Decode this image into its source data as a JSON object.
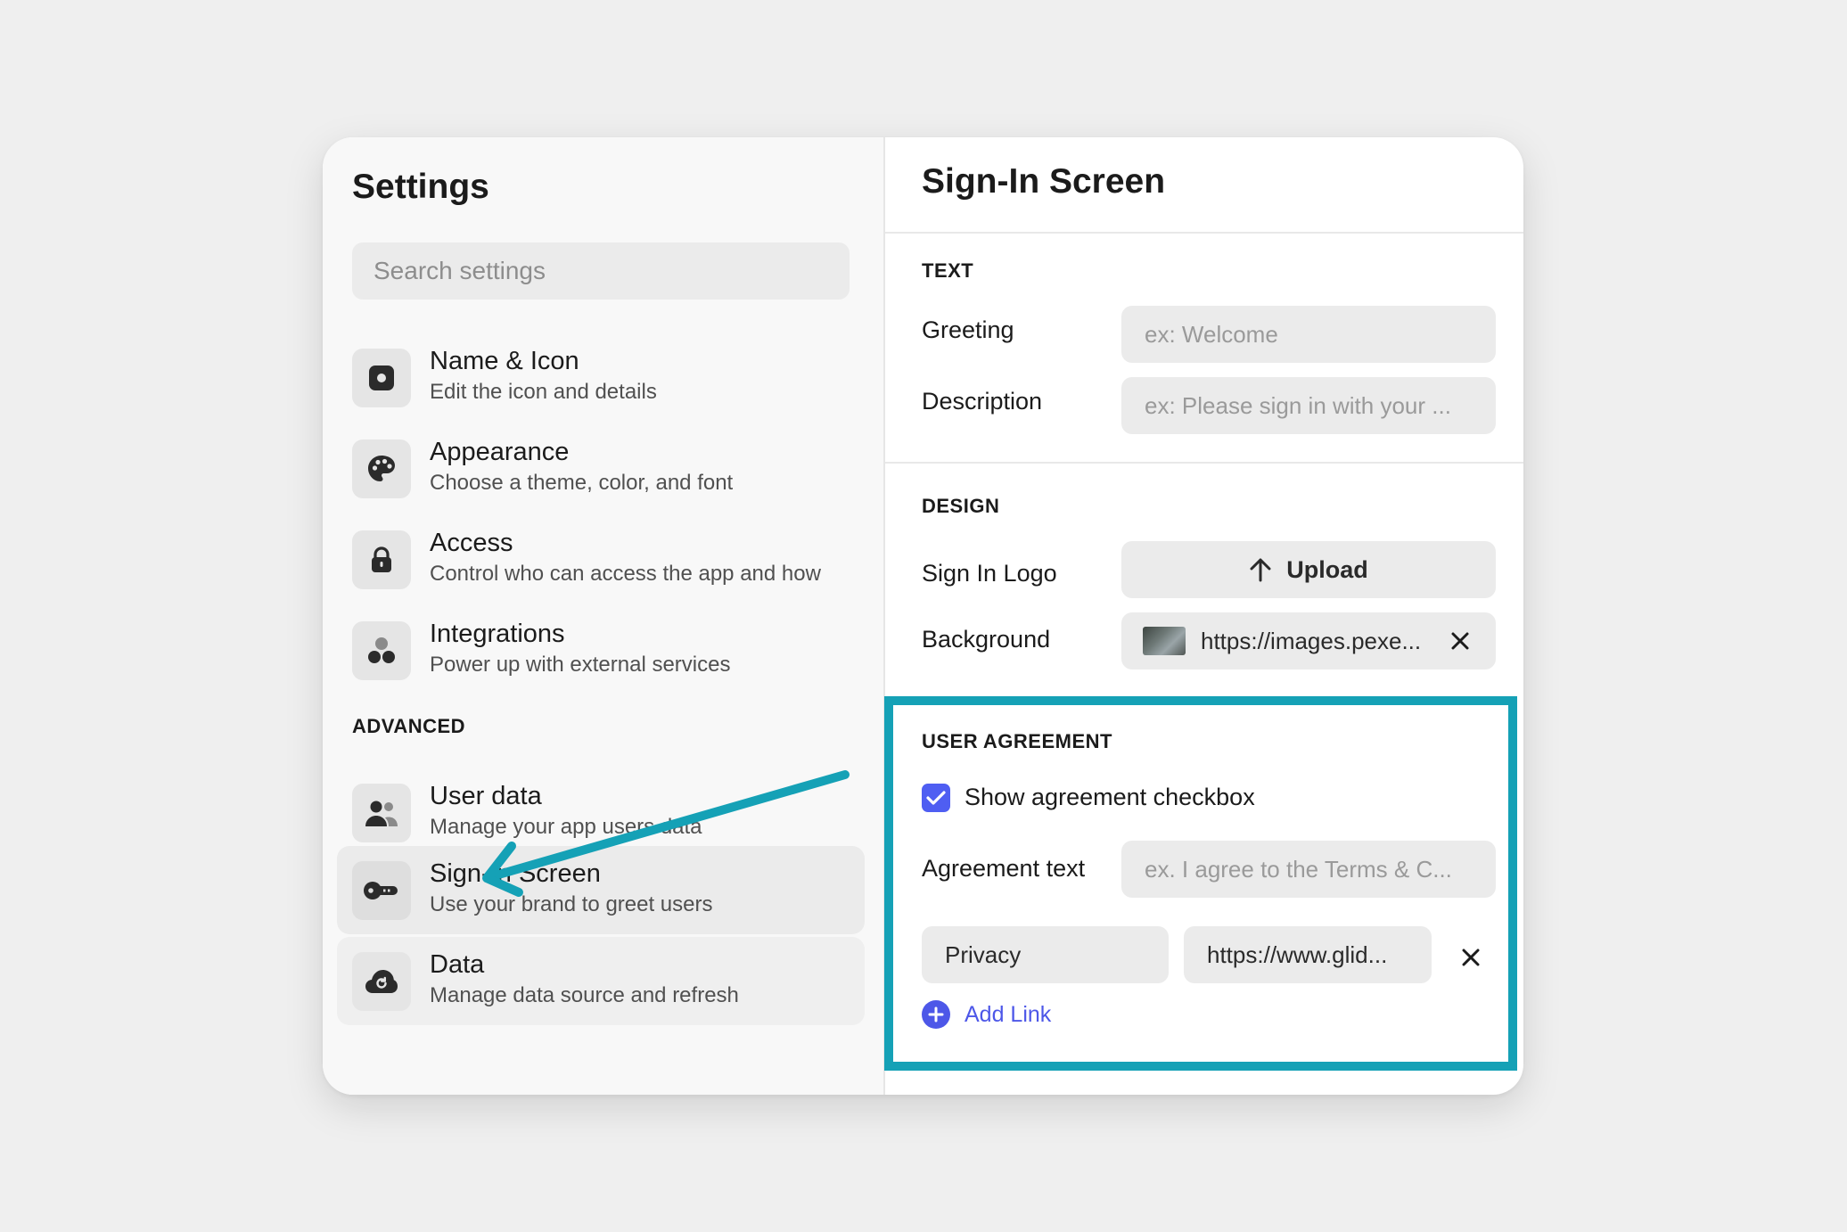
{
  "sidebar": {
    "title": "Settings",
    "search_placeholder": "Search settings",
    "items": [
      {
        "title": "Name & Icon",
        "desc": "Edit the icon and details",
        "icon": "square-dot-icon"
      },
      {
        "title": "Appearance",
        "desc": "Choose a theme, color, and font",
        "icon": "palette-icon"
      },
      {
        "title": "Access",
        "desc": "Control who can access the app and how",
        "icon": "lock-icon"
      },
      {
        "title": "Integrations",
        "desc": "Power up with external services",
        "icon": "integrations-icon"
      }
    ],
    "advanced_label": "ADVANCED",
    "advanced_items": [
      {
        "title": "User data",
        "desc": "Manage your app users data",
        "icon": "users-icon"
      },
      {
        "title": "Sign-In Screen",
        "desc": "Use your brand to greet users",
        "icon": "key-icon",
        "selected": true
      },
      {
        "title": "Data",
        "desc": "Manage data source and refresh",
        "icon": "cloud-refresh-icon"
      }
    ]
  },
  "main": {
    "title": "Sign-In Screen",
    "text_section": {
      "label": "TEXT",
      "greeting_label": "Greeting",
      "greeting_placeholder": "ex: Welcome",
      "description_label": "Description",
      "description_placeholder": "ex: Please sign in with your ..."
    },
    "design_section": {
      "label": "DESIGN",
      "logo_label": "Sign In Logo",
      "upload_label": "Upload",
      "background_label": "Background",
      "background_value": "https://images.pexe..."
    },
    "agreement_section": {
      "label": "USER AGREEMENT",
      "checkbox_label": "Show agreement checkbox",
      "checkbox_checked": true,
      "agreement_text_label": "Agreement text",
      "agreement_text_placeholder": "ex. I agree to the Terms & C...",
      "link_name": "Privacy",
      "link_url": "https://www.glid...",
      "add_link_label": "Add Link"
    }
  },
  "colors": {
    "accent": "#4f5ef2",
    "highlight": "#15a1b6",
    "background": "#efefef"
  }
}
